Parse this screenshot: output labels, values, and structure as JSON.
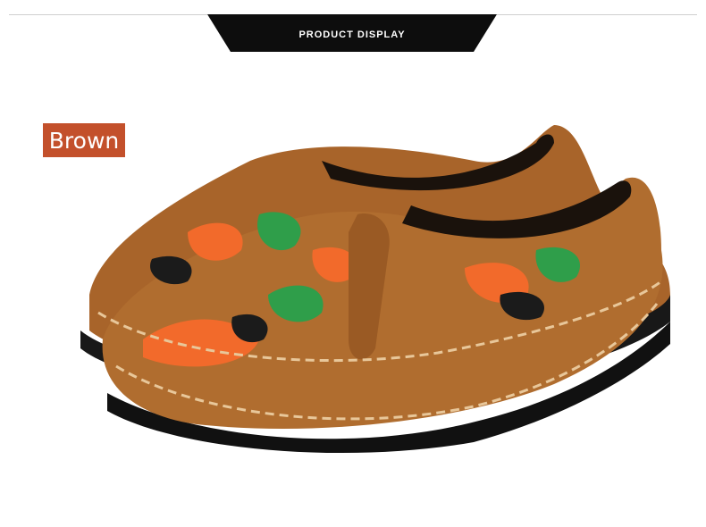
{
  "banner": {
    "title": "PRODUCT DISPLAY"
  },
  "color_badge": {
    "label": "Brown",
    "background": "#c3502b"
  },
  "product": {
    "description_icon": "camo-slip-on-shoe",
    "leather_color": "#a8642a",
    "camo_colors": [
      "#f26a2b",
      "#2f9e4a",
      "#1b1b1b",
      "#e8c67a"
    ]
  }
}
